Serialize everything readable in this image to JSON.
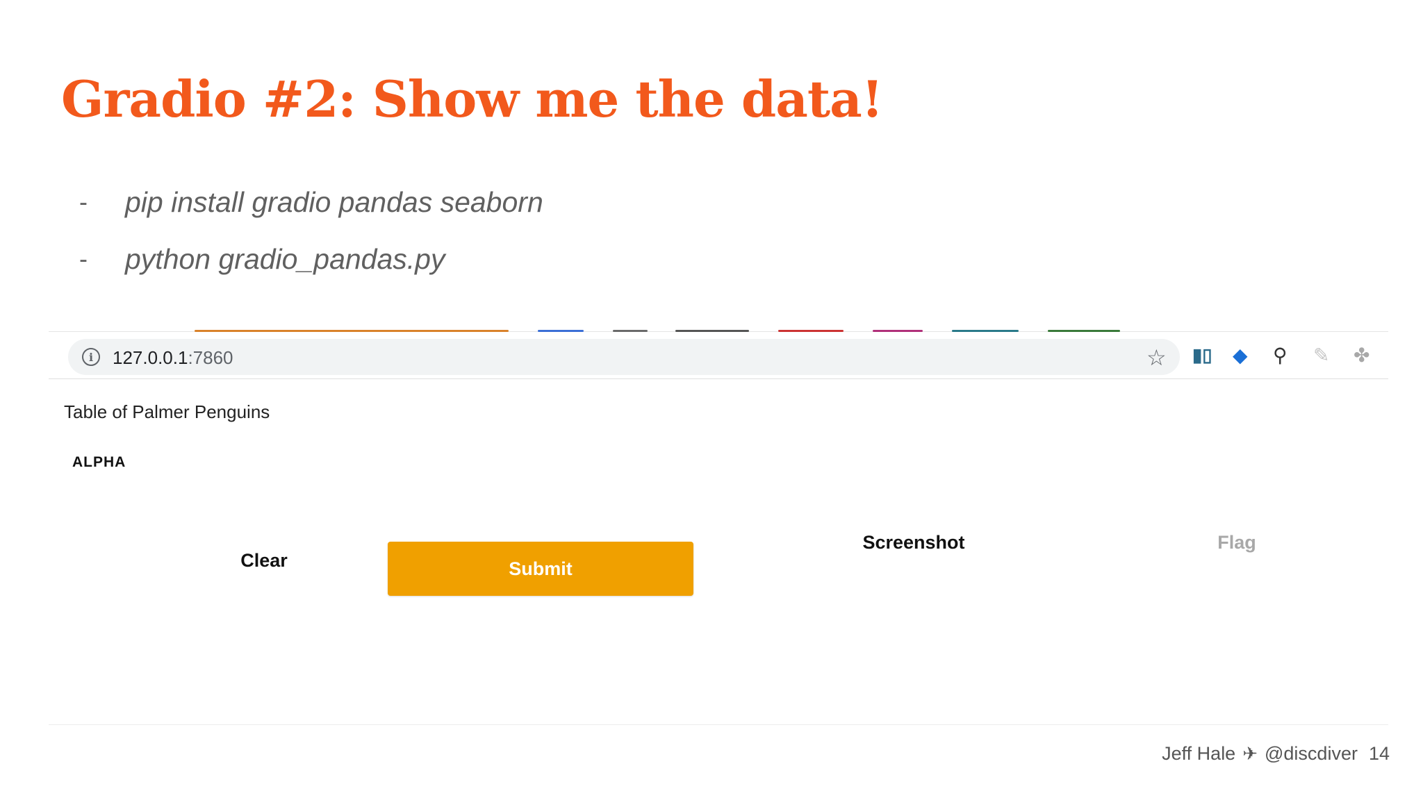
{
  "slide": {
    "title": "Gradio #2: Show me the data!",
    "bullets": [
      "pip install gradio pandas seaborn",
      "python gradio_pandas.py"
    ],
    "bullet_marker": "-",
    "title_color": "#f2591c"
  },
  "browser": {
    "url_host": "127.0.0.1",
    "url_port": ":7860",
    "info_icon": "info-icon",
    "tab_colors": [
      "#d9822b",
      "#3b6fd6",
      "#6a6a6a",
      "#555555",
      "#cc3333",
      "#b0307a",
      "#2a7a8a",
      "#3a7a3a"
    ],
    "extensions": [
      {
        "name": "bar-chart-extension-icon",
        "glyph": "▮▯"
      },
      {
        "name": "gem-extension-icon",
        "glyph": "◆"
      },
      {
        "name": "eyedropper-extension-icon",
        "glyph": "⚲"
      },
      {
        "name": "pencil-extension-icon",
        "glyph": "✎"
      },
      {
        "name": "puzzle-extension-icon",
        "glyph": "✤"
      }
    ]
  },
  "app": {
    "title": "Table of Palmer Penguins",
    "badge": "ALPHA",
    "buttons": {
      "clear": "Clear",
      "submit": "Submit",
      "screenshot": "Screenshot",
      "flag": "Flag"
    },
    "accent_color": "#f0a000"
  },
  "footer": {
    "author": "Jeff Hale",
    "separator_icon": "airplane-icon",
    "separator_glyph": "✈",
    "handle": "@discdiver",
    "page_number": "14"
  }
}
